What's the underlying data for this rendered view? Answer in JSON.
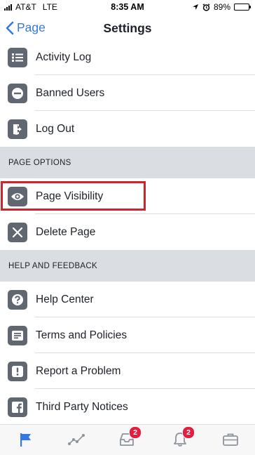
{
  "status_bar": {
    "carrier": "AT&T",
    "network": "LTE",
    "time": "8:35 AM",
    "battery": "89%",
    "battery_level": 0.89
  },
  "nav": {
    "back_label": "Page",
    "title": "Settings"
  },
  "rows_top": [
    {
      "label": "Activity Log",
      "icon": "list-icon"
    },
    {
      "label": "Banned Users",
      "icon": "banned-icon"
    },
    {
      "label": "Log Out",
      "icon": "logout-icon"
    }
  ],
  "sections": {
    "page_options": "PAGE OPTIONS",
    "help_feedback": "HELP AND FEEDBACK"
  },
  "page_options": [
    {
      "label": "Page Visibility",
      "icon": "eye-icon"
    },
    {
      "label": "Delete Page",
      "icon": "close-icon"
    }
  ],
  "help": [
    {
      "label": "Help Center",
      "icon": "question-icon"
    },
    {
      "label": "Terms and Policies",
      "icon": "document-icon"
    },
    {
      "label": "Report a Problem",
      "icon": "exclamation-icon"
    },
    {
      "label": "Third Party Notices",
      "icon": "facebook-icon"
    }
  ],
  "tab_bar": {
    "tabs": [
      {
        "name": "page",
        "icon": "flag-icon",
        "active": true
      },
      {
        "name": "insights",
        "icon": "chart-icon"
      },
      {
        "name": "inbox",
        "icon": "inbox-icon",
        "badge": "2"
      },
      {
        "name": "notifications",
        "icon": "bell-icon",
        "badge": "2"
      },
      {
        "name": "tools",
        "icon": "briefcase-icon"
      }
    ]
  },
  "colors": {
    "accent": "#3578e5",
    "icon_bg": "#606770",
    "section_bg": "#dadde1",
    "highlight": "#d0232c",
    "badge": "#e41e3f"
  }
}
